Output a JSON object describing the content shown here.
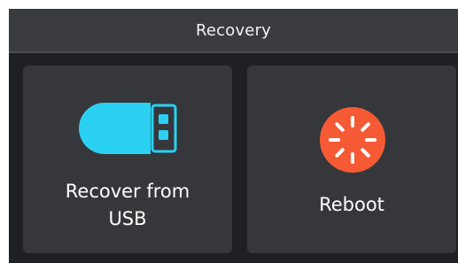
{
  "header": {
    "title": "Recovery"
  },
  "actions": [
    {
      "label": "Recover from\nUSB",
      "icon": "usb-drive-icon"
    },
    {
      "label": "Reboot",
      "icon": "reboot-spinner-icon"
    }
  ],
  "colors": {
    "usb_icon": "#2ad1f3",
    "reboot_icon": "#f55a35",
    "background": "#1f2024",
    "tile": "#36373b",
    "titlebar": "#3a3b3f"
  }
}
